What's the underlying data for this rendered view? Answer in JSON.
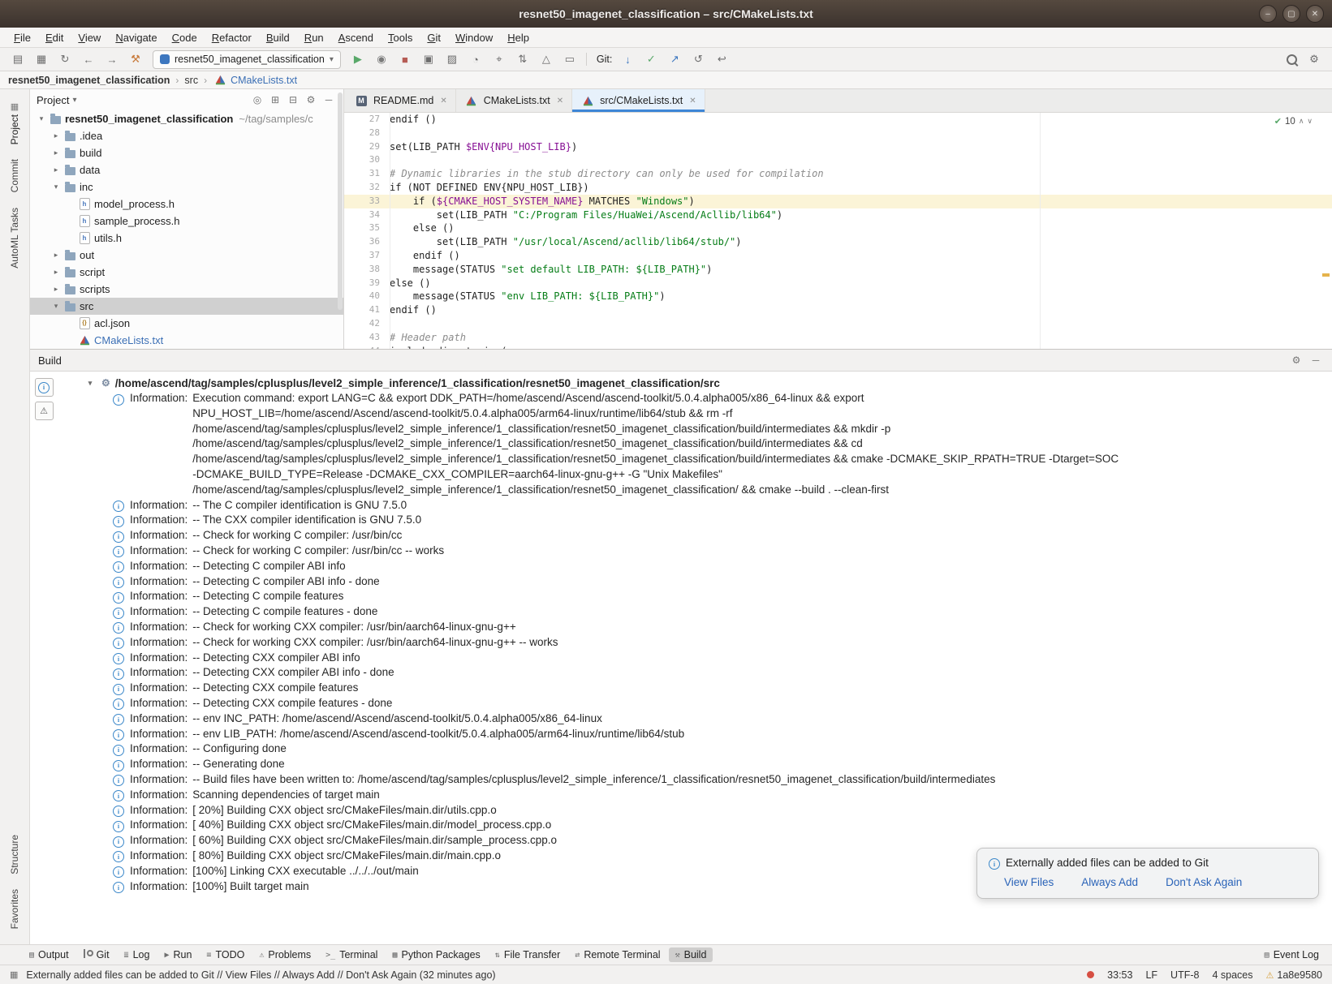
{
  "colors": {
    "accent": "#3e86d6",
    "info": "#3a87c9",
    "success": "#59a869",
    "warning": "#d6a243",
    "error": "#d64f43",
    "selection": "#d0d0d0",
    "current_line": "#fbf4d7"
  },
  "window": {
    "title": "resnet50_imagenet_classification – src/CMakeLists.txt",
    "controls": [
      {
        "n": "minimize-button",
        "g": "–"
      },
      {
        "n": "maximize-button",
        "g": "▢"
      },
      {
        "n": "close-button",
        "g": "✕"
      }
    ]
  },
  "menubar": [
    "File",
    "Edit",
    "View",
    "Navigate",
    "Code",
    "Refactor",
    "Build",
    "Run",
    "Ascend",
    "Tools",
    "Git",
    "Window",
    "Help"
  ],
  "toolbar": {
    "left_icons": [
      {
        "n": "open-icon",
        "g": "▤"
      },
      {
        "n": "save-all-icon",
        "g": "▦"
      },
      {
        "n": "sync-icon",
        "g": "↻"
      },
      {
        "n": "back-icon",
        "g": "←"
      },
      {
        "n": "forward-icon",
        "g": "→"
      },
      {
        "n": "build-hammer-icon",
        "g": "⚒",
        "c": "#c87a3a"
      }
    ],
    "project_selector": "resnet50_imagenet_classification",
    "run_icons": [
      {
        "n": "run-icon",
        "g": "▶",
        "c": "#59a869"
      },
      {
        "n": "debug-icon",
        "g": "◉",
        "c": "#7a7a7a"
      },
      {
        "n": "stop-icon",
        "g": "■",
        "c": "#b65c55"
      },
      {
        "n": "run-configurations-icon",
        "g": "▣"
      },
      {
        "n": "coverage-icon",
        "g": "▨"
      },
      {
        "n": "profiler-icon",
        "g": "◔"
      },
      {
        "n": "attach-icon",
        "g": "⌖"
      },
      {
        "n": "sync-files-icon",
        "g": "⇅"
      },
      {
        "n": "ascend-icon",
        "g": "△"
      },
      {
        "n": "terminal-icon",
        "g": "▭"
      }
    ],
    "git_label": "Git:",
    "git_icons": [
      {
        "n": "update-project-icon",
        "g": "↓",
        "c": "#3d77bf"
      },
      {
        "n": "commit-icon",
        "g": "✓",
        "c": "#59a869"
      },
      {
        "n": "push-icon",
        "g": "↗",
        "c": "#3d77bf"
      },
      {
        "n": "history-icon",
        "g": "↺"
      },
      {
        "n": "rollback-icon",
        "g": "↩"
      }
    ],
    "right_icons": [
      {
        "n": "search-everywhere-icon",
        "cls": "lens"
      },
      {
        "n": "settings-icon",
        "g": "⚙"
      }
    ]
  },
  "breadcrumb": [
    {
      "label": "resnet50_imagenet_classification",
      "bold": true
    },
    {
      "label": "src"
    },
    {
      "label": "CMakeLists.txt",
      "icon": "cmake",
      "link": true
    }
  ],
  "stripe": {
    "top": [
      {
        "label": "Project",
        "icon": "▦",
        "active": true
      },
      {
        "label": "Commit"
      },
      {
        "label": "AutoML Tasks"
      }
    ],
    "bottom": [
      {
        "label": "Structure"
      },
      {
        "label": "Favorites"
      }
    ]
  },
  "project_panel": {
    "header": "Project",
    "header_icons": [
      {
        "n": "locate-icon",
        "g": "◎"
      },
      {
        "n": "expand-all-icon",
        "g": "⊞"
      },
      {
        "n": "collapse-all-icon",
        "g": "⊟"
      },
      {
        "n": "settings-icon",
        "g": "⚙"
      },
      {
        "n": "hide-icon",
        "g": "─"
      }
    ],
    "tree": [
      {
        "label": "resnet50_imagenet_classification",
        "hint": "~/tag/samples/c",
        "depth": 0,
        "icon": "folder",
        "chevron": "open",
        "bold": true
      },
      {
        "label": ".idea",
        "depth": 1,
        "icon": "folder",
        "chevron": "closed"
      },
      {
        "label": "build",
        "depth": 1,
        "icon": "folder",
        "chevron": "closed"
      },
      {
        "label": "data",
        "depth": 1,
        "icon": "folder",
        "chevron": "closed"
      },
      {
        "label": "inc",
        "depth": 1,
        "icon": "folder",
        "chevron": "open"
      },
      {
        "label": "model_process.h",
        "depth": 2,
        "icon": "hfile"
      },
      {
        "label": "sample_process.h",
        "depth": 2,
        "icon": "hfile"
      },
      {
        "label": "utils.h",
        "depth": 2,
        "icon": "hfile"
      },
      {
        "label": "out",
        "depth": 1,
        "icon": "folder",
        "chevron": "closed"
      },
      {
        "label": "script",
        "depth": 1,
        "icon": "folder",
        "chevron": "closed"
      },
      {
        "label": "scripts",
        "depth": 1,
        "icon": "folder",
        "chevron": "closed"
      },
      {
        "label": "src",
        "depth": 1,
        "icon": "folder",
        "chevron": "open",
        "selected": true
      },
      {
        "label": "acl.json",
        "depth": 2,
        "icon": "json"
      },
      {
        "label": "CMakeLists.txt",
        "depth": 2,
        "icon": "cmake",
        "open_file": true
      }
    ]
  },
  "editor": {
    "tabs": [
      {
        "label": "README.md",
        "icon": "md"
      },
      {
        "label": "CMakeLists.txt",
        "icon": "cmake"
      },
      {
        "label": "src/CMakeLists.txt",
        "icon": "cmake",
        "active": true
      }
    ],
    "inspections": "10",
    "lines": [
      {
        "num": 27,
        "s": [
          [
            "k",
            "endif"
          ],
          [
            "p",
            " ()"
          ]
        ]
      },
      {
        "num": 28,
        "s": []
      },
      {
        "num": 29,
        "s": [
          [
            "k",
            "set"
          ],
          [
            "p",
            "(LIB_PATH "
          ],
          [
            "v",
            "$ENV{NPU_HOST_LIB}"
          ],
          [
            "p",
            ")"
          ]
        ]
      },
      {
        "num": 30,
        "s": []
      },
      {
        "num": 31,
        "s": [
          [
            "c",
            "# Dynamic libraries in the stub directory can only be used for compilation"
          ]
        ]
      },
      {
        "num": 32,
        "s": [
          [
            "k",
            "if"
          ],
          [
            "p",
            " (NOT DEFINED ENV{NPU_HOST_LIB})"
          ]
        ]
      },
      {
        "num": 33,
        "hl": true,
        "s": [
          [
            "p",
            "    "
          ],
          [
            "k",
            "if"
          ],
          [
            "p",
            " ("
          ],
          [
            "v",
            "${CMAKE_HOST_SYSTEM_NAME}"
          ],
          [
            "p",
            " MATCHES "
          ],
          [
            "s",
            "\"Windows\""
          ],
          [
            "p",
            ")"
          ]
        ]
      },
      {
        "num": 34,
        "s": [
          [
            "p",
            "        "
          ],
          [
            "k",
            "set"
          ],
          [
            "p",
            "(LIB_PATH "
          ],
          [
            "s",
            "\"C:/Program Files/HuaWei/Ascend/Acllib/lib64\""
          ],
          [
            "p",
            ")"
          ]
        ]
      },
      {
        "num": 35,
        "s": [
          [
            "p",
            "    "
          ],
          [
            "k",
            "else"
          ],
          [
            "p",
            " ()"
          ]
        ]
      },
      {
        "num": 36,
        "s": [
          [
            "p",
            "        "
          ],
          [
            "k",
            "set"
          ],
          [
            "p",
            "(LIB_PATH "
          ],
          [
            "s",
            "\"/usr/local/Ascend/acllib/lib64/stub/\""
          ],
          [
            "p",
            ")"
          ]
        ]
      },
      {
        "num": 37,
        "s": [
          [
            "p",
            "    "
          ],
          [
            "k",
            "endif"
          ],
          [
            "p",
            " ()"
          ]
        ]
      },
      {
        "num": 38,
        "s": [
          [
            "p",
            "    "
          ],
          [
            "k",
            "message"
          ],
          [
            "p",
            "(STATUS "
          ],
          [
            "s",
            "\"set default LIB_PATH: ${LIB_PATH}\""
          ],
          [
            "p",
            ")"
          ]
        ]
      },
      {
        "num": 39,
        "s": [
          [
            "k",
            "else"
          ],
          [
            "p",
            " ()"
          ]
        ]
      },
      {
        "num": 40,
        "s": [
          [
            "p",
            "    "
          ],
          [
            "k",
            "message"
          ],
          [
            "p",
            "(STATUS "
          ],
          [
            "s",
            "\"env LIB_PATH: ${LIB_PATH}\""
          ],
          [
            "p",
            ")"
          ]
        ]
      },
      {
        "num": 41,
        "s": [
          [
            "k",
            "endif"
          ],
          [
            "p",
            " ()"
          ]
        ]
      },
      {
        "num": 42,
        "s": []
      },
      {
        "num": 43,
        "s": [
          [
            "c",
            "# Header path"
          ]
        ]
      },
      {
        "num": 44,
        "s": [
          [
            "k",
            "include_directories"
          ],
          [
            "p",
            "("
          ]
        ]
      }
    ]
  },
  "build_panel": {
    "title": "Build",
    "header_icons": [
      {
        "n": "settings-icon",
        "g": "⚙"
      },
      {
        "n": "hide-icon",
        "g": "─"
      }
    ],
    "gutter_icons": [
      {
        "n": "info-filter-icon",
        "g": "i"
      },
      {
        "n": "warning-filter-icon",
        "g": "⚠"
      }
    ],
    "root_path": "/home/ascend/tag/samples/cplusplus/level2_simple_inference/1_classification/resnet50_imagenet_classification/src",
    "messages": [
      {
        "label": "Information:",
        "lines": [
          "Execution command: export LANG=C && export DDK_PATH=/home/ascend/Ascend/ascend-toolkit/5.0.4.alpha005/x86_64-linux && export",
          "NPU_HOST_LIB=/home/ascend/Ascend/ascend-toolkit/5.0.4.alpha005/arm64-linux/runtime/lib64/stub && rm -rf",
          "/home/ascend/tag/samples/cplusplus/level2_simple_inference/1_classification/resnet50_imagenet_classification/build/intermediates && mkdir -p",
          "/home/ascend/tag/samples/cplusplus/level2_simple_inference/1_classification/resnet50_imagenet_classification/build/intermediates && cd",
          "/home/ascend/tag/samples/cplusplus/level2_simple_inference/1_classification/resnet50_imagenet_classification/build/intermediates && cmake -DCMAKE_SKIP_RPATH=TRUE -Dtarget=SOC",
          "-DCMAKE_BUILD_TYPE=Release -DCMAKE_CXX_COMPILER=aarch64-linux-gnu-g++ -G \"Unix Makefiles\"",
          "/home/ascend/tag/samples/cplusplus/level2_simple_inference/1_classification/resnet50_imagenet_classification/ && cmake --build . --clean-first"
        ]
      },
      {
        "label": "Information:",
        "lines": [
          "-- The C compiler identification is GNU 7.5.0"
        ]
      },
      {
        "label": "Information:",
        "lines": [
          "-- The CXX compiler identification is GNU 7.5.0"
        ]
      },
      {
        "label": "Information:",
        "lines": [
          "-- Check for working C compiler: /usr/bin/cc"
        ]
      },
      {
        "label": "Information:",
        "lines": [
          "-- Check for working C compiler: /usr/bin/cc -- works"
        ]
      },
      {
        "label": "Information:",
        "lines": [
          "-- Detecting C compiler ABI info"
        ]
      },
      {
        "label": "Information:",
        "lines": [
          "-- Detecting C compiler ABI info - done"
        ]
      },
      {
        "label": "Information:",
        "lines": [
          "-- Detecting C compile features"
        ]
      },
      {
        "label": "Information:",
        "lines": [
          "-- Detecting C compile features - done"
        ]
      },
      {
        "label": "Information:",
        "lines": [
          "-- Check for working CXX compiler: /usr/bin/aarch64-linux-gnu-g++"
        ]
      },
      {
        "label": "Information:",
        "lines": [
          "-- Check for working CXX compiler: /usr/bin/aarch64-linux-gnu-g++ -- works"
        ]
      },
      {
        "label": "Information:",
        "lines": [
          "-- Detecting CXX compiler ABI info"
        ]
      },
      {
        "label": "Information:",
        "lines": [
          "-- Detecting CXX compiler ABI info - done"
        ]
      },
      {
        "label": "Information:",
        "lines": [
          "-- Detecting CXX compile features"
        ]
      },
      {
        "label": "Information:",
        "lines": [
          "-- Detecting CXX compile features - done"
        ]
      },
      {
        "label": "Information:",
        "lines": [
          "-- env INC_PATH: /home/ascend/Ascend/ascend-toolkit/5.0.4.alpha005/x86_64-linux"
        ]
      },
      {
        "label": "Information:",
        "lines": [
          "-- env LIB_PATH: /home/ascend/Ascend/ascend-toolkit/5.0.4.alpha005/arm64-linux/runtime/lib64/stub"
        ]
      },
      {
        "label": "Information:",
        "lines": [
          "-- Configuring done"
        ]
      },
      {
        "label": "Information:",
        "lines": [
          "-- Generating done"
        ]
      },
      {
        "label": "Information:",
        "lines": [
          "-- Build files have been written to: /home/ascend/tag/samples/cplusplus/level2_simple_inference/1_classification/resnet50_imagenet_classification/build/intermediates"
        ]
      },
      {
        "label": "Information:",
        "lines": [
          "Scanning dependencies of target main"
        ]
      },
      {
        "label": "Information:",
        "lines": [
          "[ 20%] Building CXX object src/CMakeFiles/main.dir/utils.cpp.o"
        ]
      },
      {
        "label": "Information:",
        "lines": [
          "[ 40%] Building CXX object src/CMakeFiles/main.dir/model_process.cpp.o"
        ]
      },
      {
        "label": "Information:",
        "lines": [
          "[ 60%] Building CXX object src/CMakeFiles/main.dir/sample_process.cpp.o"
        ]
      },
      {
        "label": "Information:",
        "lines": [
          "[ 80%] Building CXX object src/CMakeFiles/main.dir/main.cpp.o"
        ]
      },
      {
        "label": "Information:",
        "lines": [
          "[100%] Linking CXX executable ../../../out/main"
        ]
      },
      {
        "label": "Information:",
        "lines": [
          "[100%] Built target main"
        ]
      }
    ]
  },
  "notification": {
    "title": "Externally added files can be added to Git",
    "actions": [
      "View Files",
      "Always Add",
      "Don't Ask Again"
    ]
  },
  "bottom_bar": {
    "items": [
      {
        "label": "Output",
        "n": "output",
        "g": "▤"
      },
      {
        "label": "Git",
        "n": "git",
        "cls": "i-gitb"
      },
      {
        "label": "Log",
        "n": "log",
        "g": "≣"
      },
      {
        "label": "Run",
        "n": "run",
        "g": "▶"
      },
      {
        "label": "TODO",
        "n": "todo",
        "g": "≡"
      },
      {
        "label": "Problems",
        "n": "problems",
        "g": "⚠"
      },
      {
        "label": "Terminal",
        "n": "terminal",
        "g": ">_"
      },
      {
        "label": "Python Packages",
        "n": "python-packages",
        "g": "▦"
      },
      {
        "label": "File Transfer",
        "n": "file-transfer",
        "g": "⇅"
      },
      {
        "label": "Remote Terminal",
        "n": "remote-terminal",
        "g": "⇄"
      },
      {
        "label": "Build",
        "n": "build",
        "g": "⚒",
        "active": true
      }
    ],
    "right_items": [
      {
        "label": "Event Log",
        "n": "event-log",
        "g": "▤"
      }
    ]
  },
  "status_bar": {
    "message": "Externally added files can be added to Git // View Files // Always Add // Don't Ask Again (32 minutes ago)",
    "position": "33:53",
    "line_separator": "LF",
    "encoding": "UTF-8",
    "indent": "4 spaces",
    "revision": "1a8e9580"
  }
}
